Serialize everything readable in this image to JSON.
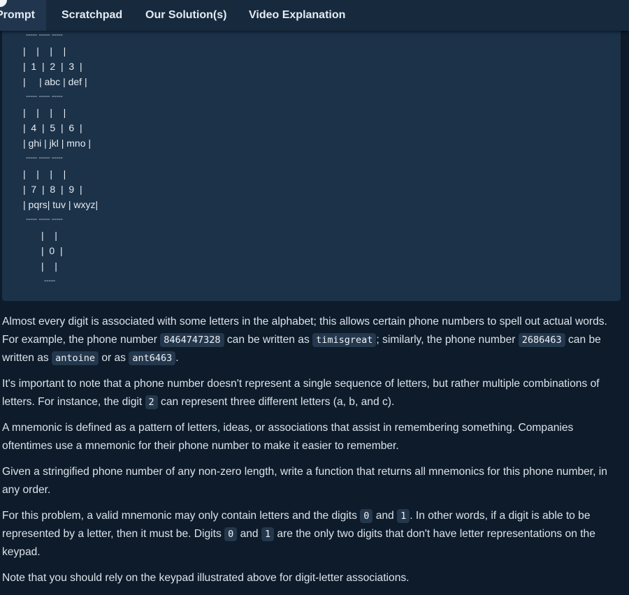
{
  "tabs": [
    "Prompt",
    "Scratchpad",
    "Our Solution(s)",
    "Video Explanation"
  ],
  "keypad": {
    "dash3": "----- ----- -----",
    "dash1": "-----",
    "spacer": "|    |    |    |",
    "row1_digits": "|  1  |  2  |  3  |",
    "row1_letters": "|     | abc | def |",
    "row2_digits": "|  4  |  5  |  6  |",
    "row2_letters": "| ghi | jkl | mno |",
    "row3_digits": "|  7  |  8  |  9  |",
    "row3_letters": "| pqrs| tuv | wxyz|",
    "zero_spacer": "|    |",
    "zero_digit": "|  0  |"
  },
  "para1": {
    "a": "Almost every digit is associated with some letters in the alphabet; this allows certain phone numbers to spell out actual words. For example, the phone number ",
    "c1": "8464747328",
    "b": " can be written as ",
    "c2": "timisgreat",
    "c": "; similarly, the phone number ",
    "c3": "2686463",
    "d": " can be written as ",
    "c4": "antoine",
    "e": " or as ",
    "c5": "ant6463",
    "f": "."
  },
  "para2": {
    "a": "It's important to note that a phone number doesn't represent a single sequence of letters, but rather multiple combinations of letters. For instance, the digit ",
    "c1": "2",
    "b": " can represent three different letters (a, b, and c)."
  },
  "para3": "A mnemonic is defined as a pattern of letters, ideas, or associations that assist in remembering something. Companies oftentimes use a mnemonic for their phone number to make it easier to remember.",
  "para4": "Given a stringified phone number of any non-zero length, write a function that returns all mnemonics for this phone number, in any order.",
  "para5": {
    "a": "For this problem, a valid mnemonic may only contain letters and the digits ",
    "c1": "0",
    "b": " and ",
    "c2": "1",
    "c": ". In other words, if a digit is able to be represented by a letter, then it must be. Digits ",
    "c3": "0",
    "d": " and ",
    "c4": "1",
    "e": " are the only two digits that don't have letter representations on the keypad."
  },
  "para6": "Note that you should rely on the keypad illustrated above for digit-letter associations."
}
